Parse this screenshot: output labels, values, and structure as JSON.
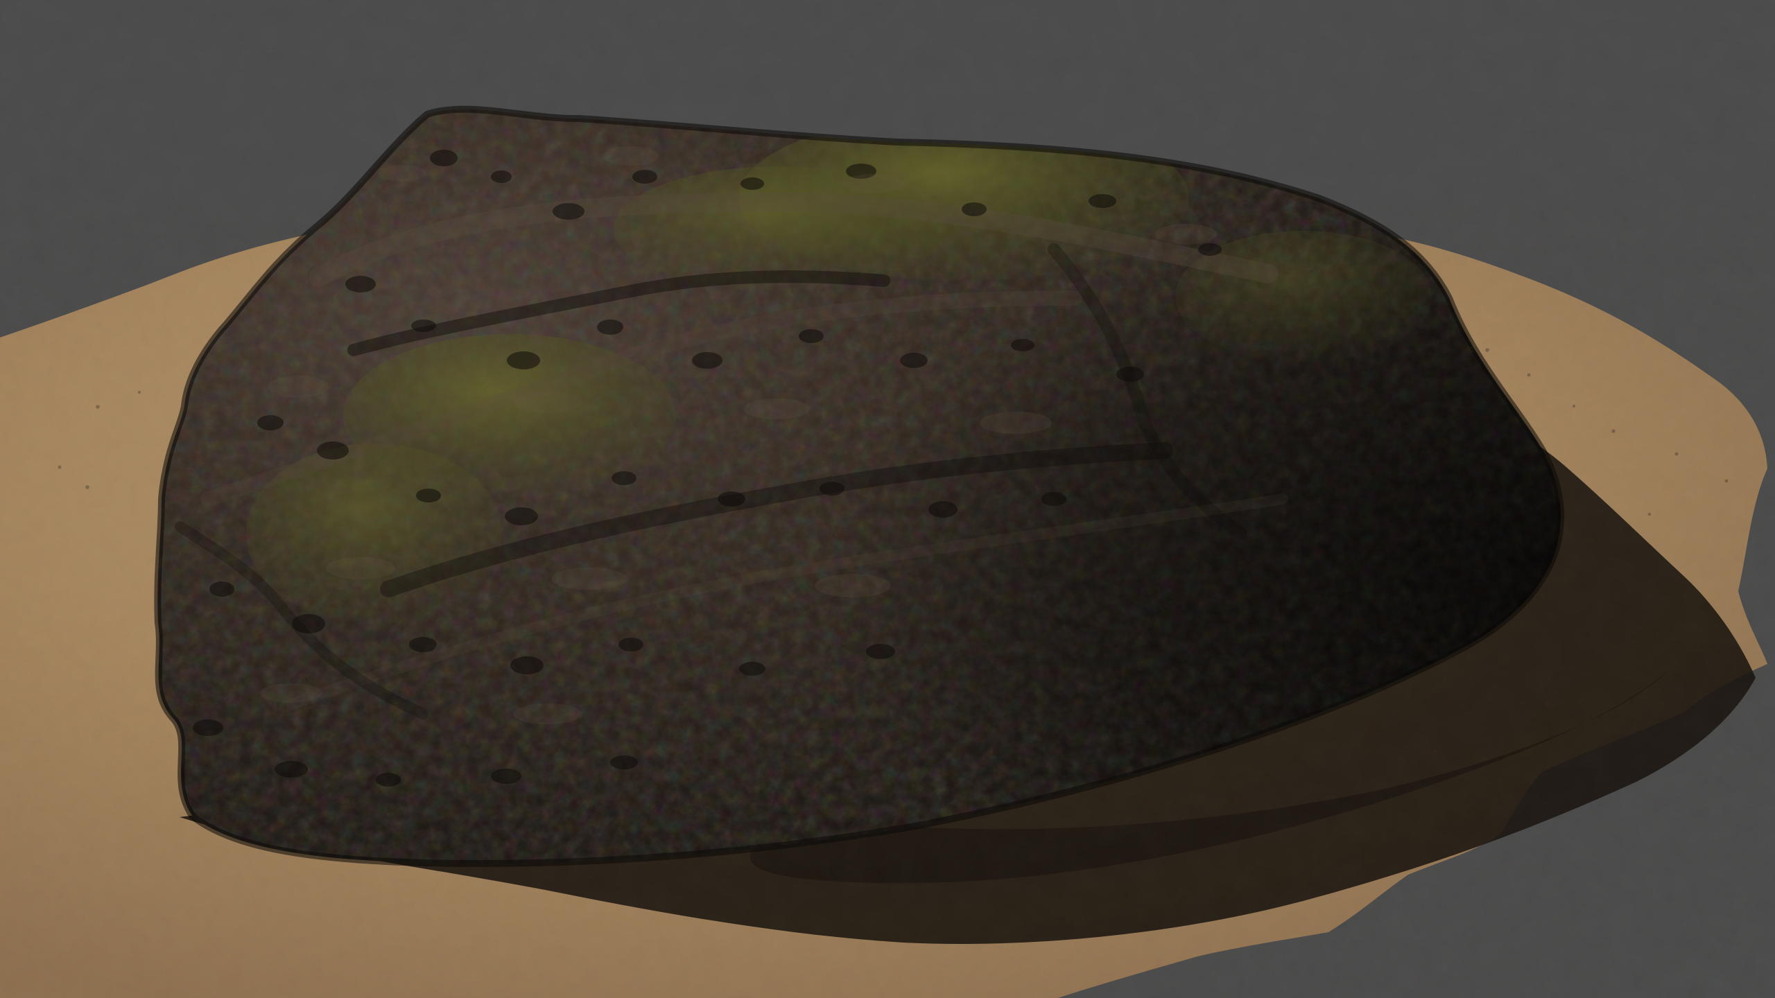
{
  "viewport": {
    "background_color": "#4b4b4b"
  },
  "scene": {
    "subject": "rock",
    "ground": "sand",
    "colors": {
      "sand_light": "#b5976f",
      "sand_mid": "#a38362",
      "sand_dark": "#7d6346",
      "shadow": "#1f1812",
      "rock_dark": "#1a1511",
      "rock_mid": "#2d2520",
      "rock_light": "#4a3c33",
      "moss": "#5b5b24"
    }
  }
}
